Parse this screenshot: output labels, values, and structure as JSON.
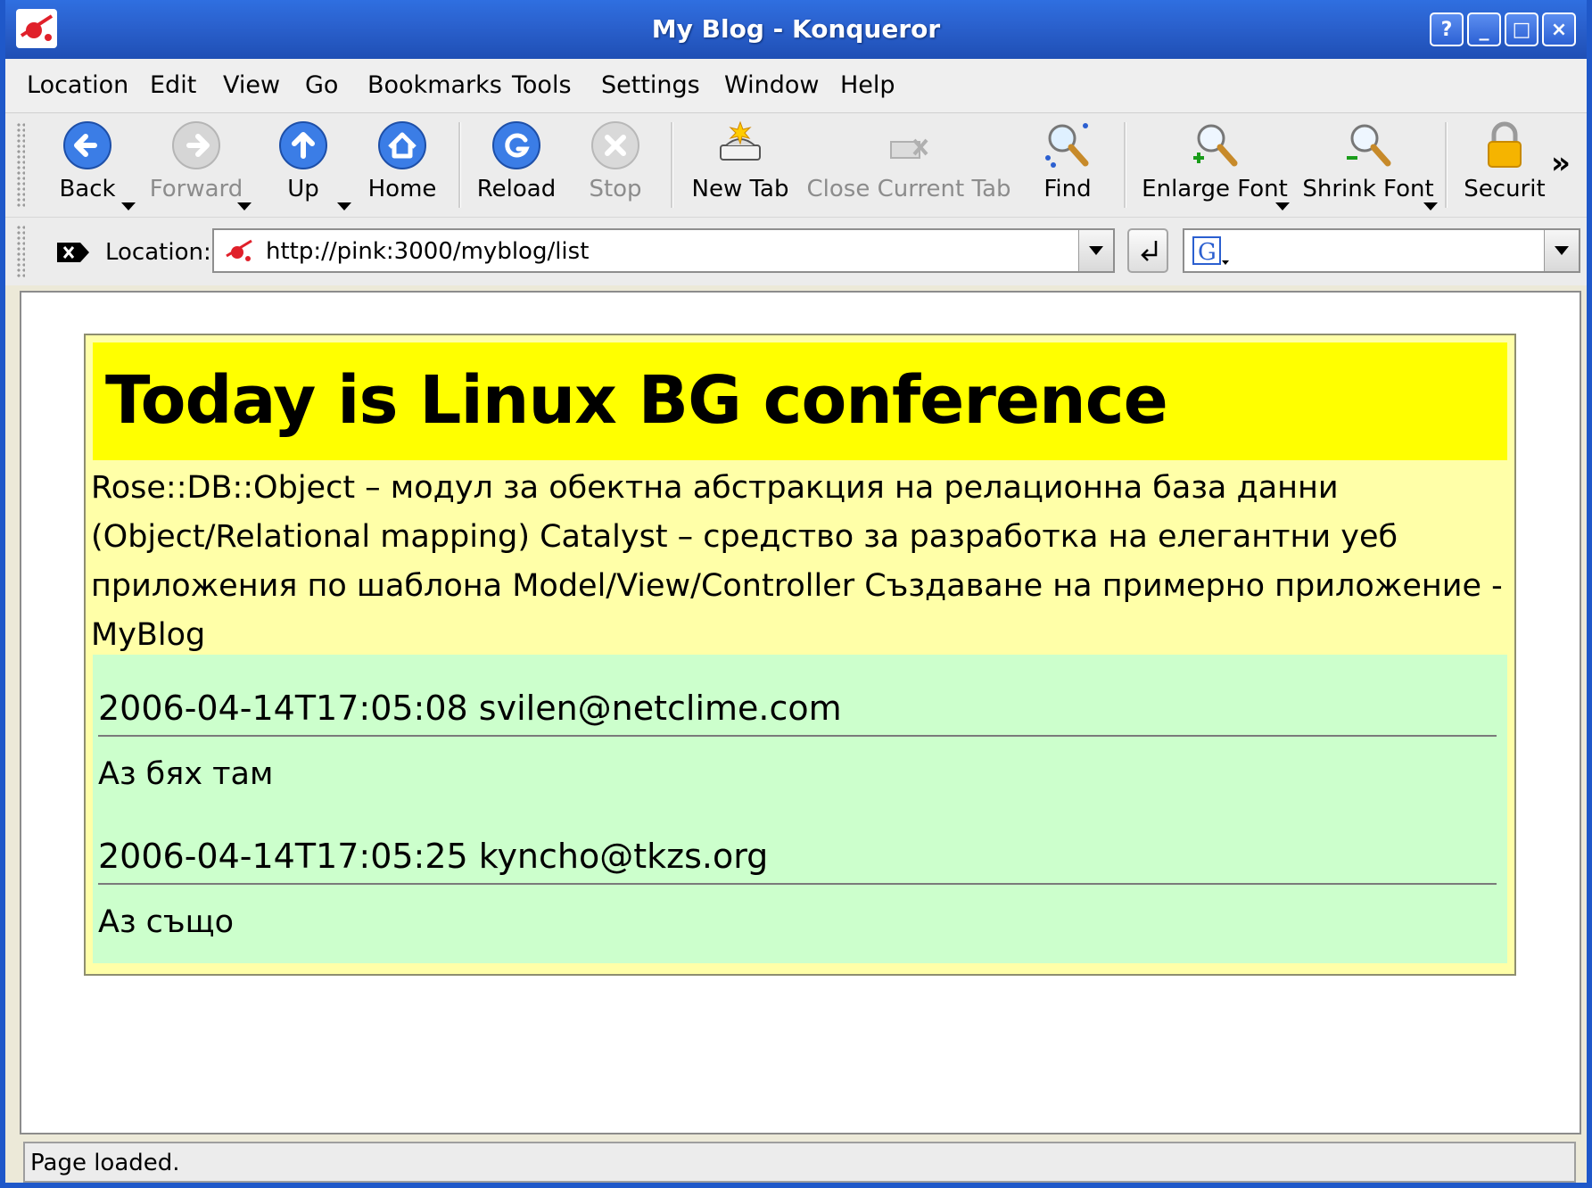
{
  "window": {
    "title": "My Blog - Konqueror",
    "buttons": {
      "help": "?",
      "minimize": "_",
      "maximize": "□",
      "close": "×"
    }
  },
  "menu": [
    {
      "label": "Location"
    },
    {
      "label": "Edit"
    },
    {
      "label": "View"
    },
    {
      "label": "Go"
    },
    {
      "label": "Bookmarks"
    },
    {
      "label": "Tools"
    },
    {
      "label": "Settings"
    },
    {
      "label": "Window"
    },
    {
      "label": "Help"
    }
  ],
  "toolbar": {
    "back": "Back",
    "forward": "Forward",
    "up": "Up",
    "home": "Home",
    "reload": "Reload",
    "stop": "Stop",
    "new_tab": "New Tab",
    "close_tab": "Close Current Tab",
    "find": "Find",
    "enlarge_font": "Enlarge Font",
    "shrink_font": "Shrink Font",
    "security": "Securit",
    "overflow": "»"
  },
  "location": {
    "label": "Location:",
    "url": "http://pink:3000/myblog/list",
    "search_value": ""
  },
  "page": {
    "headline": "Today is Linux BG conference",
    "description": "Rose::DB::Object – модул за обектна абстракция на релационна база данни (Object/Relational mapping) Catalyst – средство за разработка на елегантни уеб приложения по шаблона Model/View/Controller Създаване на примерно приложение - MyBlog",
    "comments": [
      {
        "header": "2006-04-14T17:05:08 svilen@netclime.com",
        "body": "Аз бях там"
      },
      {
        "header": "2006-04-14T17:05:25 kyncho@tkzs.org",
        "body": "Аз също"
      }
    ]
  },
  "status": {
    "text": "Page loaded."
  },
  "colors": {
    "titlebar": "#2b62cf",
    "headline_bg": "#ffff00",
    "post_bg": "#ffffa8",
    "comments_bg": "#ccffcc"
  }
}
